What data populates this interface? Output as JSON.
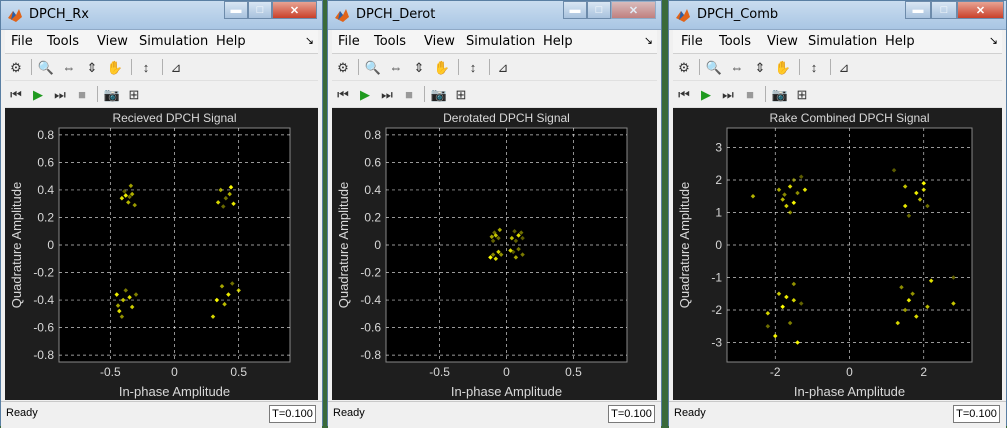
{
  "colors": {
    "plot_bg": "#1e1e1e",
    "axes_bg": "#000000",
    "grid": "#ffffff",
    "points": "#ffff00",
    "text": "#d8d8d8"
  },
  "windows": [
    {
      "title": "DPCH_Rx",
      "menu": [
        "File",
        "Tools",
        "View",
        "Simulation",
        "Help"
      ],
      "status": "Ready",
      "time_label": "T=0.100",
      "chart_data": {
        "type": "scatter",
        "title": "Recieved DPCH Signal",
        "xlabel": "In-phase Amplitude",
        "ylabel": "Quadrature Amplitude",
        "xlim": [
          -0.9,
          0.9
        ],
        "ylim": [
          -0.85,
          0.85
        ],
        "xticks": [
          -0.5,
          0,
          0.5
        ],
        "xtick_labels": [
          "-0.5",
          "0",
          "0.5"
        ],
        "yticks": [
          0.8,
          0.6,
          0.4,
          0.2,
          0,
          -0.2,
          -0.4,
          -0.6,
          -0.8
        ],
        "ytick_labels": [
          "0.8",
          "0.6",
          "0.4",
          "0.2",
          "0",
          "-0.2",
          "-0.4",
          "-0.6",
          "-0.8"
        ],
        "grid": true,
        "points": [
          [
            -0.34,
            0.43
          ],
          [
            -0.38,
            0.36
          ],
          [
            -0.33,
            0.37
          ],
          [
            -0.41,
            0.34
          ],
          [
            -0.36,
            0.31
          ],
          [
            -0.31,
            0.29
          ],
          [
            -0.39,
            0.39
          ],
          [
            -0.35,
            0.35
          ],
          [
            0.44,
            0.42
          ],
          [
            0.36,
            0.4
          ],
          [
            0.4,
            0.34
          ],
          [
            0.34,
            0.31
          ],
          [
            0.43,
            0.37
          ],
          [
            0.46,
            0.3
          ],
          [
            0.38,
            0.28
          ],
          [
            -0.4,
            -0.4
          ],
          [
            -0.35,
            -0.38
          ],
          [
            -0.44,
            -0.44
          ],
          [
            -0.3,
            -0.36
          ],
          [
            -0.41,
            -0.52
          ],
          [
            -0.38,
            -0.33
          ],
          [
            -0.33,
            -0.45
          ],
          [
            -0.45,
            -0.36
          ],
          [
            -0.43,
            -0.48
          ],
          [
            0.37,
            -0.3
          ],
          [
            0.42,
            -0.36
          ],
          [
            0.5,
            -0.33
          ],
          [
            0.33,
            -0.4
          ],
          [
            0.3,
            -0.52
          ],
          [
            0.45,
            -0.28
          ],
          [
            0.39,
            -0.43
          ]
        ]
      }
    },
    {
      "title": "DPCH_Derot",
      "menu": [
        "File",
        "Tools",
        "View",
        "Simulation",
        "Help"
      ],
      "status": "Ready",
      "time_label": "T=0.100",
      "chart_data": {
        "type": "scatter",
        "title": "Derotated DPCH Signal",
        "xlabel": "In-phase Amplitude",
        "ylabel": "Quadrature Amplitude",
        "xlim": [
          -0.9,
          0.9
        ],
        "ylim": [
          -0.85,
          0.85
        ],
        "xticks": [
          -0.5,
          0,
          0.5
        ],
        "xtick_labels": [
          "-0.5",
          "0",
          "0.5"
        ],
        "yticks": [
          0.8,
          0.6,
          0.4,
          0.2,
          0,
          -0.2,
          -0.4,
          -0.6,
          -0.8
        ],
        "ytick_labels": [
          "0.8",
          "0.6",
          "0.4",
          "0.2",
          "0",
          "-0.2",
          "-0.4",
          "-0.6",
          "-0.8"
        ],
        "grid": true,
        "points": [
          [
            -0.09,
            0.09
          ],
          [
            -0.06,
            0.05
          ],
          [
            -0.1,
            0.03
          ],
          [
            -0.05,
            0.11
          ],
          [
            -0.08,
            0.07
          ],
          [
            -0.11,
            0.06
          ],
          [
            0.06,
            0.1
          ],
          [
            0.09,
            0.07
          ],
          [
            0.04,
            0.05
          ],
          [
            0.11,
            0.09
          ],
          [
            0.07,
            0.03
          ],
          [
            0.12,
            0.05
          ],
          [
            -0.1,
            -0.07
          ],
          [
            -0.06,
            -0.05
          ],
          [
            -0.12,
            -0.09
          ],
          [
            -0.08,
            -0.1
          ],
          [
            -0.04,
            -0.07
          ],
          [
            0.05,
            -0.05
          ],
          [
            0.09,
            -0.03
          ],
          [
            0.12,
            -0.07
          ],
          [
            0.07,
            -0.09
          ],
          [
            0.03,
            -0.04
          ]
        ]
      }
    },
    {
      "title": "DPCH_Comb",
      "menu": [
        "File",
        "Tools",
        "View",
        "Simulation",
        "Help"
      ],
      "status": "Ready",
      "time_label": "T=0.100",
      "chart_data": {
        "type": "scatter",
        "title": "Rake Combined DPCH Signal",
        "xlabel": "In-phase Amplitude",
        "ylabel": "Quadrature Amplitude",
        "xlim": [
          -3.3,
          3.3
        ],
        "ylim": [
          -3.6,
          3.6
        ],
        "xticks": [
          -2,
          0,
          2
        ],
        "xtick_labels": [
          "-2",
          "0",
          "2"
        ],
        "yticks": [
          3,
          2,
          1,
          0,
          -1,
          -2,
          -3
        ],
        "ytick_labels": [
          "3",
          "2",
          "1",
          "0",
          "-1",
          "-2",
          "-3"
        ],
        "grid": true,
        "points": [
          [
            -1.6,
            1.8
          ],
          [
            -1.4,
            1.6
          ],
          [
            -1.8,
            1.4
          ],
          [
            -1.5,
            2.0
          ],
          [
            -1.7,
            1.2
          ],
          [
            -2.6,
            1.5
          ],
          [
            -1.3,
            2.1
          ],
          [
            -1.9,
            1.7
          ],
          [
            -1.6,
            1.0
          ],
          [
            -1.2,
            1.7
          ],
          [
            -1.5,
            1.3
          ],
          [
            -1.75,
            1.55
          ],
          [
            1.2,
            2.3
          ],
          [
            1.5,
            1.8
          ],
          [
            1.8,
            1.6
          ],
          [
            2.0,
            1.9
          ],
          [
            1.5,
            1.2
          ],
          [
            1.9,
            1.4
          ],
          [
            2.1,
            1.2
          ],
          [
            1.6,
            0.9
          ],
          [
            2.0,
            1.7
          ],
          [
            -1.7,
            -1.6
          ],
          [
            -1.5,
            -1.7
          ],
          [
            -2.2,
            -2.1
          ],
          [
            -1.9,
            -1.5
          ],
          [
            -1.6,
            -2.4
          ],
          [
            -1.3,
            -1.8
          ],
          [
            -2.0,
            -2.8
          ],
          [
            -1.4,
            -3.0
          ],
          [
            -2.2,
            -2.5
          ],
          [
            -1.8,
            -1.9
          ],
          [
            -1.5,
            -1.2
          ],
          [
            1.4,
            -1.3
          ],
          [
            1.7,
            -1.5
          ],
          [
            2.2,
            -1.1
          ],
          [
            2.8,
            -1.0
          ],
          [
            1.5,
            -2.0
          ],
          [
            1.8,
            -2.2
          ],
          [
            1.3,
            -2.4
          ],
          [
            2.1,
            -1.9
          ],
          [
            2.8,
            -1.8
          ],
          [
            1.6,
            -1.7
          ]
        ]
      }
    }
  ]
}
